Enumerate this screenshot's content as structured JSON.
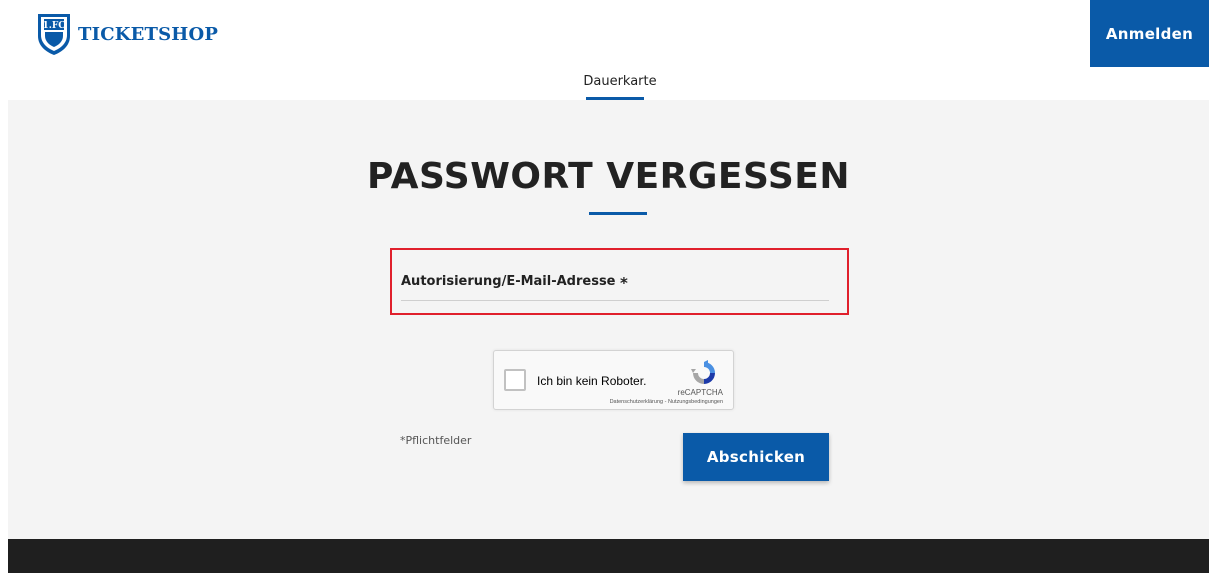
{
  "header": {
    "brand": "TICKETSHOP",
    "login_label": "Anmelden",
    "logo_icon": "club-crest-icon"
  },
  "nav": {
    "tabs": [
      {
        "label": "Dauerkarte",
        "active": true
      }
    ]
  },
  "main": {
    "title": "PASSWORT VERGESSEN",
    "field": {
      "label": "Autorisierung/E-Mail-Adresse",
      "required_mark": "*",
      "value": "",
      "highlight_color": "#e0202c"
    },
    "captcha": {
      "label": "Ich bin kein Roboter.",
      "brand": "reCAPTCHA",
      "links": "Datenschutzerklärung - Nutzungsbedingungen",
      "checked": false
    },
    "required_note": "*Pflichtfelder",
    "submit_label": "Abschicken"
  },
  "colors": {
    "accent": "#0a5aa8",
    "background": "#f4f4f4",
    "footer": "#1f1f1f"
  }
}
